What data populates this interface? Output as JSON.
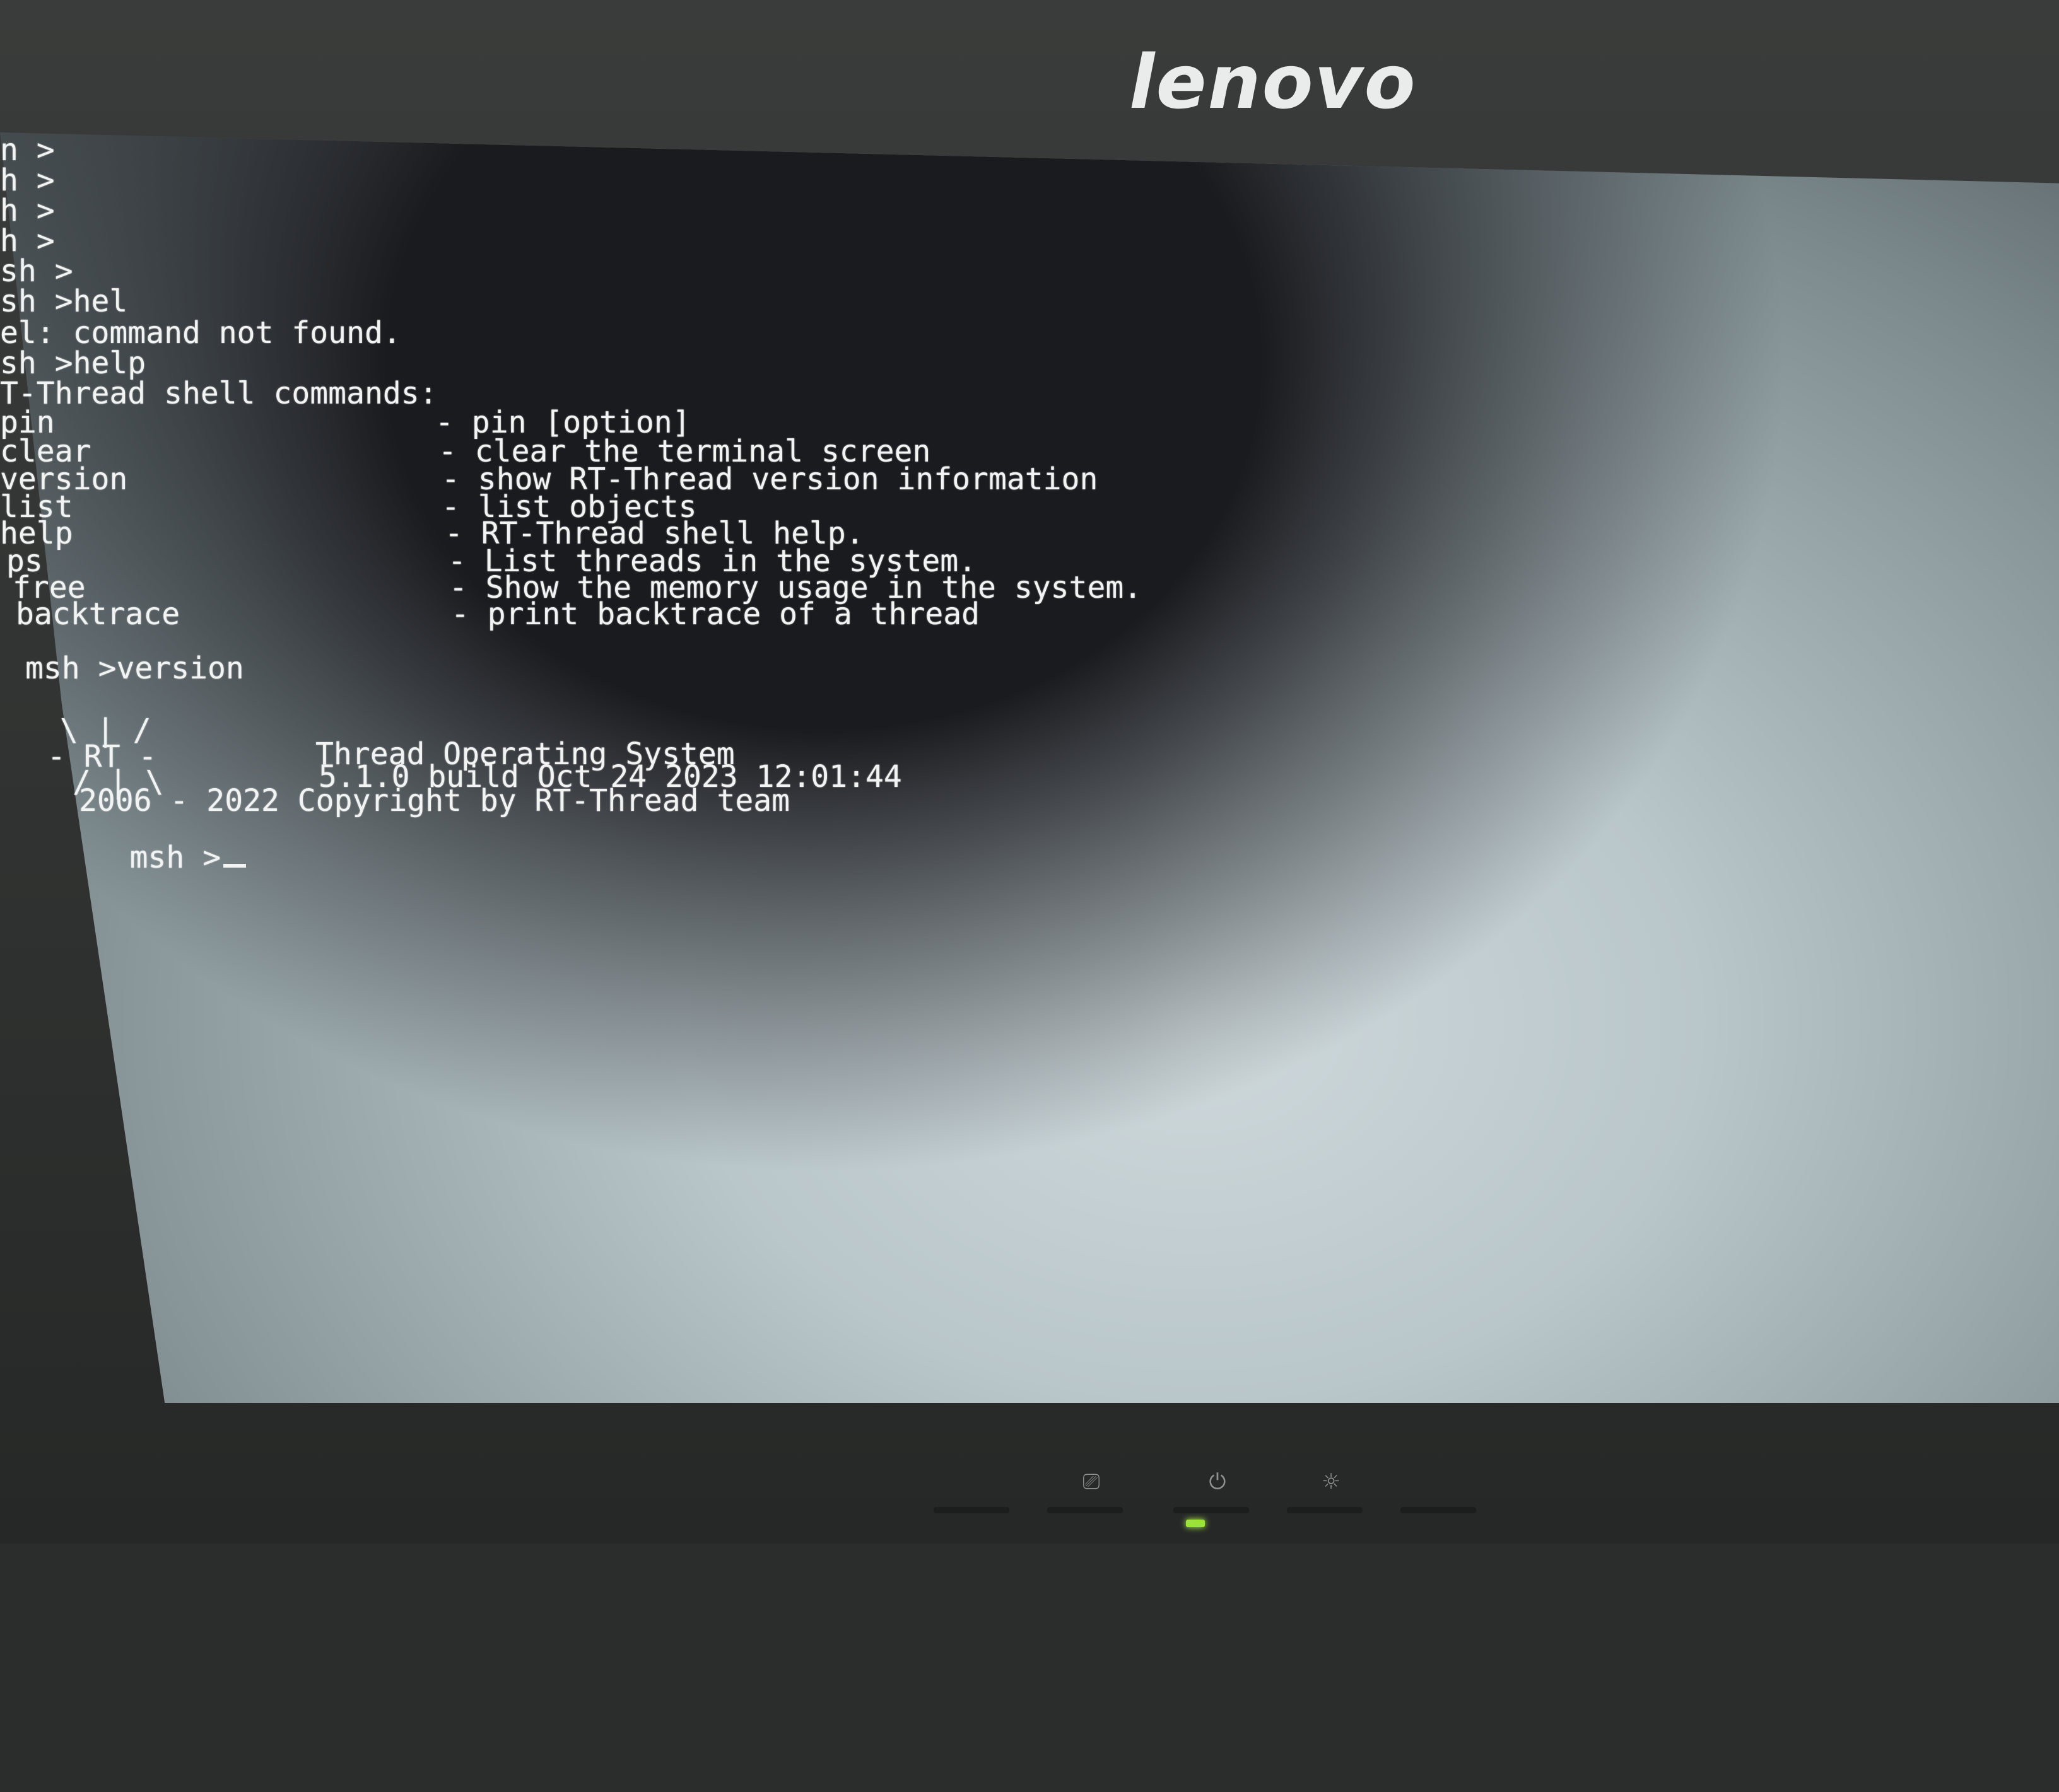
{
  "monitor": {
    "brand": "lenovo",
    "power_icon": "power-icon",
    "brightness_icon": "brightness-icon",
    "input_icon": "input-source-icon",
    "menu_icon": "menu-icon",
    "power_led_color": "#9be33a"
  },
  "terminal": {
    "prompt_history": [
      "n >",
      "h >",
      "h >",
      "h >",
      "sh >"
    ],
    "lines": [
      "sh >hel",
      "el: command not found.",
      "sh >help",
      "T-Thread shell commands:"
    ],
    "commands": [
      {
        "name": "pin",
        "desc": "- pin [option]"
      },
      {
        "name": "clear",
        "desc": "- clear the terminal screen"
      },
      {
        "name": "version",
        "desc": "- show RT-Thread version information"
      },
      {
        "name": "list",
        "desc": "- list objects"
      },
      {
        "name": "help",
        "desc": "- RT-Thread shell help."
      },
      {
        "name": "ps",
        "desc": "- List threads in the system."
      },
      {
        "name": "free",
        "desc": "- Show the memory usage in the system."
      },
      {
        "name": "backtrace",
        "desc": "- print backtrace of a thread"
      }
    ],
    "version_cmd": "msh >version",
    "logo": {
      "row1": "\\ | /",
      "row2": "- RT -",
      "row3": "/ | \\",
      "title": "Thread Operating System",
      "build": "5.1.0 build Oct 24 2023 12:01:44",
      "copyright": "2006 - 2022 Copyright by RT-Thread team"
    },
    "final_prompt": "msh >"
  }
}
